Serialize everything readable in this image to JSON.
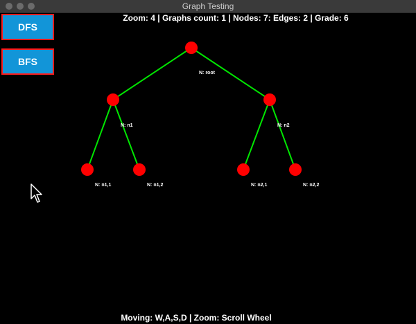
{
  "window": {
    "title": "Graph Testing"
  },
  "status_top": "Zoom: 4 | Graphs count: 1 | Nodes: 7: Edges: 2 | Grade: 6",
  "status_bottom": "Moving: W,A,S,D | Zoom: Scroll Wheel",
  "buttons": {
    "dfs": "DFS",
    "bfs": "BFS"
  },
  "colors": {
    "node": "#ff0000",
    "edge": "#00e600",
    "button_bg": "#1295d8",
    "button_border": "#ff1b1b"
  },
  "graph": {
    "nodes": [
      {
        "label": "N: root"
      },
      {
        "label": "N: n1"
      },
      {
        "label": "N: n2"
      },
      {
        "label": "N: n1,1"
      },
      {
        "label": "N: n1,2"
      },
      {
        "label": "N: n2,1"
      },
      {
        "label": "N: n2,2"
      }
    ]
  }
}
